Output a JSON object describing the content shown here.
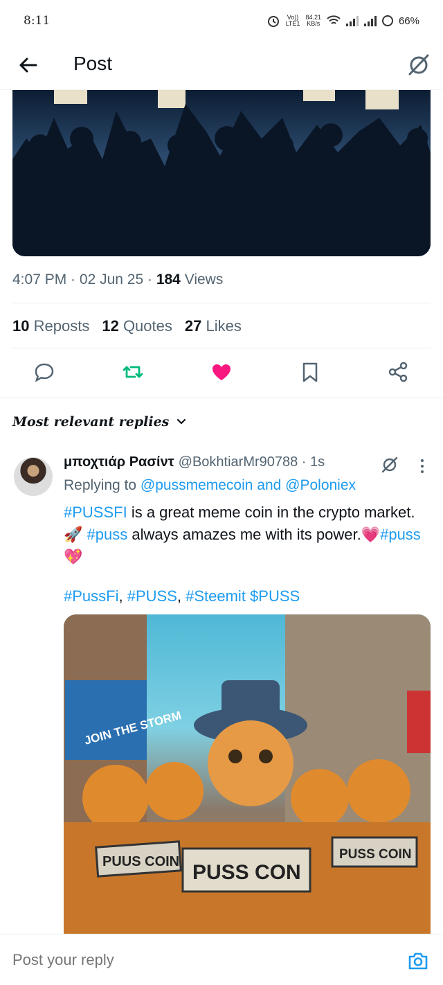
{
  "status_bar": {
    "time": "8:11",
    "net_top": "Vo))",
    "net_bottom": "LTE1",
    "speed_top": "84.21",
    "speed_bottom": "KB/s",
    "battery": "66%"
  },
  "header": {
    "title": "Post"
  },
  "post": {
    "time": "4:07 PM",
    "date": "02 Jun 25",
    "views_count": "184",
    "views_label": "Views",
    "reposts_count": "10",
    "reposts_label": "Reposts",
    "quotes_count": "12",
    "quotes_label": "Quotes",
    "likes_count": "27",
    "likes_label": "Likes"
  },
  "colors": {
    "accent": "#1d9bf0",
    "like": "#f91880",
    "repost": "#00ba7c",
    "muted": "#536471"
  },
  "replies": {
    "sort_label": "Most relevant replies",
    "items": [
      {
        "author": "μποχτιάρ Ρασίντ",
        "handle": "@BokhtiarMr90788",
        "time": "1s",
        "replying_prefix": "Replying to",
        "replying_to": "@pussmemecoin and @Poloniex",
        "text_tag1": "#PUSSFI",
        "text_part1": " is a great meme coin in the crypto market. 🚀 ",
        "text_tag2": "#puss",
        "text_part2": " always amazes me with its power.💗",
        "text_tag3": "#puss",
        "text_part3": "💖",
        "tags_1": "#PussFi",
        "tags_sep1": ", ",
        "tags_2": "#PUSS",
        "tags_sep2": ", ",
        "tags_3": "#Steemit",
        "tags_4": " $PUSS",
        "image_sign_1": "JOIN THE STORM",
        "image_sign_2": "PUUS COIN",
        "image_sign_3": "PUSS CON",
        "image_sign_4": "PUSS COIN"
      }
    ]
  },
  "composer": {
    "placeholder": "Post your reply"
  }
}
